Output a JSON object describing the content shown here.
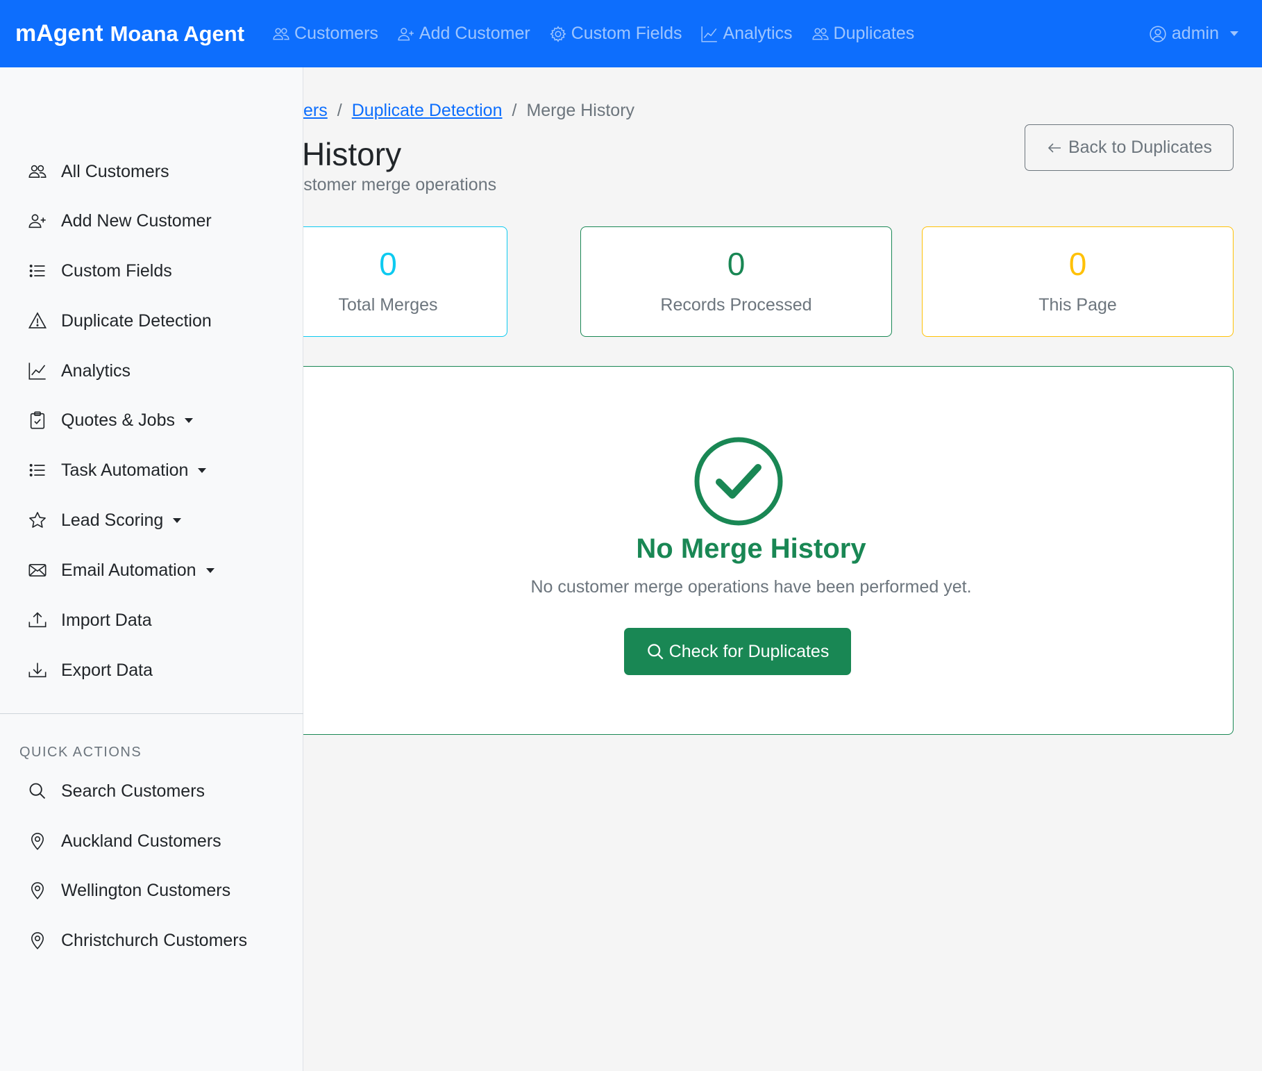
{
  "navbar": {
    "brand_primary": "mAgent",
    "brand_secondary": "Moana Agent",
    "links": [
      {
        "label": "Customers",
        "icon": "people-icon"
      },
      {
        "label": "Add Customer",
        "icon": "person-plus-icon"
      },
      {
        "label": "Custom Fields",
        "icon": "gear-icon"
      },
      {
        "label": "Analytics",
        "icon": "graph-up-icon"
      },
      {
        "label": "Duplicates",
        "icon": "people-icon"
      }
    ],
    "user": {
      "label": "admin",
      "icon": "person-circle-icon"
    }
  },
  "sidebar": {
    "items": [
      {
        "label": "All Customers",
        "icon": "people-icon"
      },
      {
        "label": "Add New Customer",
        "icon": "person-plus-icon"
      },
      {
        "label": "Custom Fields",
        "icon": "list-icon"
      },
      {
        "label": "Duplicate Detection",
        "icon": "warning-triangle-icon"
      },
      {
        "label": "Analytics",
        "icon": "graph-up-icon"
      },
      {
        "label": "Quotes & Jobs",
        "icon": "clipboard-check-icon",
        "dropdown": true
      },
      {
        "label": "Task Automation",
        "icon": "list-icon",
        "dropdown": true
      },
      {
        "label": "Lead Scoring",
        "icon": "star-icon",
        "dropdown": true
      },
      {
        "label": "Email Automation",
        "icon": "envelope-icon",
        "dropdown": true
      },
      {
        "label": "Import Data",
        "icon": "upload-icon"
      },
      {
        "label": "Export Data",
        "icon": "download-icon"
      }
    ],
    "quick_actions_heading": "QUICK ACTIONS",
    "quick_actions": [
      {
        "label": "Search Customers",
        "icon": "search-icon"
      },
      {
        "label": "Auckland Customers",
        "icon": "geo-pin-icon"
      },
      {
        "label": "Wellington Customers",
        "icon": "geo-pin-icon"
      },
      {
        "label": "Christchurch Customers",
        "icon": "geo-pin-icon"
      }
    ]
  },
  "breadcrumb": {
    "items": [
      "ers",
      "Duplicate Detection"
    ],
    "separator": "/",
    "current": "Merge History"
  },
  "page": {
    "title": "ge History",
    "subtitle": "il of all customer merge operations",
    "back_button": "Back to Duplicates",
    "back_icon": "arrow-left-icon"
  },
  "stats": [
    {
      "value": "0",
      "label": "Total Merges",
      "color": "#0dcaf0"
    },
    {
      "value": "0",
      "label": "Records Processed",
      "color": "#198754"
    },
    {
      "value": "0",
      "label": "This Page",
      "color": "#ffc107"
    }
  ],
  "empty_state": {
    "icon": "check-circle-icon",
    "title": "No Merge History",
    "text": "No customer merge operations have been performed yet.",
    "button": "Check for Duplicates",
    "button_icon": "search-icon"
  },
  "colors": {
    "primary": "#0d6efd",
    "success": "#198754",
    "info": "#0dcaf0",
    "warning": "#ffc107",
    "muted": "#6c757d"
  }
}
